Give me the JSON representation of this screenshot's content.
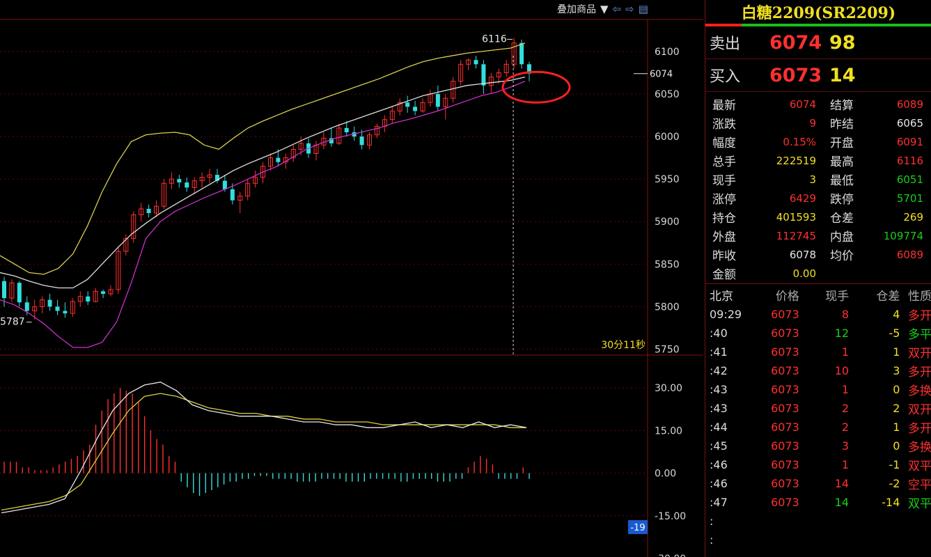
{
  "toolbar": {
    "overlay_label": "叠加商品",
    "dropdown_icon": "triangle-down-icon",
    "prev_icon": "arrow-left-icon",
    "next_icon": "arrow-right-icon",
    "layout_icon": "panel-layout-icon"
  },
  "colors": {
    "up": "#ff3030",
    "down": "#33dddd",
    "boll_upper": "#d8d050",
    "boll_mid": "#e0e0e0",
    "boll_lower": "#cc30cc",
    "macd_dif": "#e8e8e8",
    "macd_dea": "#e0d040",
    "highlight_circle": "#ff2020"
  },
  "chart_data": [
    {
      "type": "candlestick",
      "y_ticks": [
        "6100",
        "6050",
        "6000",
        "5950",
        "5900",
        "5850",
        "5800",
        "5750"
      ],
      "ylim": [
        5743,
        6136
      ],
      "annotations": {
        "high_label": "6116",
        "low_label": "5787",
        "last_label": "6074",
        "countdown": "30分11秒"
      },
      "ohlc": [
        [
          5830,
          5835,
          5800,
          5810
        ],
        [
          5810,
          5832,
          5805,
          5828
        ],
        [
          5828,
          5830,
          5800,
          5805
        ],
        [
          5805,
          5812,
          5790,
          5795
        ],
        [
          5795,
          5808,
          5785,
          5800
        ],
        [
          5800,
          5812,
          5792,
          5808
        ],
        [
          5808,
          5815,
          5795,
          5800
        ],
        [
          5800,
          5808,
          5790,
          5795
        ],
        [
          5795,
          5805,
          5787,
          5792
        ],
        [
          5792,
          5810,
          5788,
          5806
        ],
        [
          5806,
          5818,
          5800,
          5812
        ],
        [
          5812,
          5818,
          5802,
          5806
        ],
        [
          5806,
          5822,
          5805,
          5818
        ],
        [
          5818,
          5820,
          5810,
          5815
        ],
        [
          5815,
          5825,
          5812,
          5820
        ],
        [
          5820,
          5870,
          5815,
          5865
        ],
        [
          5865,
          5885,
          5860,
          5880
        ],
        [
          5880,
          5912,
          5875,
          5908
        ],
        [
          5908,
          5922,
          5900,
          5915
        ],
        [
          5915,
          5920,
          5905,
          5910
        ],
        [
          5910,
          5925,
          5905,
          5918
        ],
        [
          5918,
          5950,
          5915,
          5945
        ],
        [
          5945,
          5958,
          5938,
          5950
        ],
        [
          5950,
          5955,
          5940,
          5946
        ],
        [
          5946,
          5952,
          5935,
          5940
        ],
        [
          5940,
          5952,
          5932,
          5948
        ],
        [
          5948,
          5958,
          5940,
          5952
        ],
        [
          5952,
          5962,
          5945,
          5955
        ],
        [
          5955,
          5962,
          5945,
          5948
        ],
        [
          5948,
          5955,
          5935,
          5938
        ],
        [
          5938,
          5945,
          5920,
          5925
        ],
        [
          5925,
          5935,
          5910,
          5930
        ],
        [
          5930,
          5950,
          5925,
          5945
        ],
        [
          5945,
          5960,
          5940,
          5952
        ],
        [
          5952,
          5970,
          5945,
          5965
        ],
        [
          5965,
          5980,
          5960,
          5975
        ],
        [
          5975,
          5985,
          5965,
          5970
        ],
        [
          5970,
          5980,
          5962,
          5975
        ],
        [
          5975,
          5990,
          5970,
          5985
        ],
        [
          5985,
          6000,
          5978,
          5992
        ],
        [
          5992,
          5998,
          5975,
          5980
        ],
        [
          5980,
          5995,
          5972,
          5990
        ],
        [
          5990,
          6005,
          5985,
          5998
        ],
        [
          5998,
          6010,
          5988,
          5992
        ],
        [
          5992,
          6015,
          5990,
          6010
        ],
        [
          6010,
          6018,
          6000,
          6005
        ],
        [
          6005,
          6012,
          5995,
          6000
        ],
        [
          6000,
          6008,
          5985,
          5990
        ],
        [
          5990,
          6005,
          5985,
          6002
        ],
        [
          6002,
          6015,
          5998,
          6012
        ],
        [
          6012,
          6025,
          6005,
          6020
        ],
        [
          6020,
          6035,
          6015,
          6030
        ],
        [
          6030,
          6045,
          6025,
          6040
        ],
        [
          6040,
          6048,
          6028,
          6035
        ],
        [
          6035,
          6042,
          6025,
          6030
        ],
        [
          6030,
          6045,
          6028,
          6040
        ],
        [
          6040,
          6055,
          6035,
          6050
        ],
        [
          6050,
          6060,
          6030,
          6035
        ],
        [
          6035,
          6050,
          6020,
          6045
        ],
        [
          6045,
          6070,
          6040,
          6065
        ],
        [
          6065,
          6090,
          6060,
          6085
        ],
        [
          6085,
          6092,
          6078,
          6090
        ],
        [
          6090,
          6095,
          6080,
          6085
        ],
        [
          6085,
          6090,
          6050,
          6060
        ],
        [
          6060,
          6075,
          6050,
          6070
        ],
        [
          6070,
          6080,
          6062,
          6075
        ],
        [
          6075,
          6090,
          6070,
          6085
        ],
        [
          6085,
          6116,
          6080,
          6110
        ],
        [
          6110,
          6114,
          6080,
          6085
        ],
        [
          6085,
          6088,
          6065,
          6074
        ]
      ],
      "boll_upper": [
        5860,
        5850,
        5840,
        5838,
        5845,
        5862,
        5895,
        5935,
        5968,
        5994,
        6002,
        6004,
        6005,
        6002,
        5990,
        5985,
        5998,
        6010,
        6018,
        6025,
        6032,
        6038,
        6044,
        6050,
        6056,
        6062,
        6068,
        6075,
        6082,
        6088,
        6092,
        6095,
        6098,
        6100,
        6102,
        6104,
        6110
      ],
      "boll_mid": [
        5840,
        5836,
        5830,
        5825,
        5822,
        5822,
        5832,
        5850,
        5868,
        5885,
        5898,
        5910,
        5920,
        5930,
        5940,
        5950,
        5960,
        5968,
        5975,
        5982,
        5990,
        5998,
        6005,
        6012,
        6018,
        6024,
        6030,
        6036,
        6042,
        6048,
        6052,
        6056,
        6060,
        6062,
        6064,
        6066,
        6070
      ],
      "boll_lower": [
        5808,
        5802,
        5792,
        5780,
        5765,
        5752,
        5752,
        5758,
        5782,
        5828,
        5880,
        5900,
        5912,
        5920,
        5928,
        5935,
        5942,
        5950,
        5958,
        5965,
        5975,
        5985,
        5992,
        5998,
        6002,
        6006,
        6010,
        6016,
        6020,
        6025,
        6030,
        6036,
        6042,
        6048,
        6052,
        6058,
        6065
      ]
    },
    {
      "type": "macd",
      "y_ticks": [
        "30.00",
        "15.00",
        "0.00",
        "-15.00",
        "-30.00"
      ],
      "ylim": [
        -30,
        30
      ],
      "current_label": "-19",
      "hist": [
        4,
        4,
        4,
        2,
        2,
        1,
        1,
        1,
        2,
        3,
        4,
        5,
        6,
        8,
        10,
        17,
        22,
        26,
        28,
        30,
        29,
        28,
        25,
        20,
        15,
        12,
        10,
        6,
        4,
        -3,
        -5,
        -7,
        -8,
        -7,
        -6,
        -5,
        -4,
        -3,
        -3,
        -2,
        -2,
        -1,
        -1,
        -1,
        -2,
        -2,
        -2,
        -2,
        -3,
        -3,
        -3,
        -3,
        -2,
        -2,
        -2,
        -2,
        -3,
        -3,
        -3,
        -3,
        -2,
        -2,
        -2,
        -2,
        -2,
        -3,
        -3,
        -2,
        -2,
        -2,
        -2,
        -3,
        -3,
        -3,
        -2,
        -2,
        2,
        4,
        6,
        5,
        3,
        -2,
        -2,
        -2,
        -2,
        2,
        -2
      ],
      "dif": [
        -14,
        -13,
        -12,
        -11,
        -9,
        1,
        12,
        22,
        28,
        31,
        32,
        29,
        24,
        22,
        21,
        20,
        20,
        20,
        19,
        18,
        18,
        17,
        17,
        16,
        16,
        17,
        18,
        16,
        17,
        16,
        18,
        16,
        17,
        16
      ],
      "dea": [
        -13,
        -12,
        -11,
        -10,
        -8,
        -4,
        5,
        14,
        22,
        27,
        28,
        27,
        25,
        23,
        22,
        21,
        21,
        20,
        20,
        19,
        19,
        18,
        18,
        18,
        17,
        17,
        17,
        17,
        17,
        17,
        17,
        17,
        16,
        16
      ]
    }
  ],
  "panel": {
    "title": "白糖2209(SR2209)",
    "ask_label": "卖出",
    "ask_price": "6074",
    "ask_volume": "98",
    "bid_label": "买入",
    "bid_price": "6073",
    "bid_volume": "14",
    "stats": [
      {
        "k": "最新",
        "v": "6074",
        "vc": "red",
        "k2": "结算",
        "v2": "6089",
        "v2c": "red"
      },
      {
        "k": "涨跌",
        "v": "9",
        "vc": "red",
        "k2": "昨结",
        "v2": "6065",
        "v2c": "white"
      },
      {
        "k": "幅度",
        "v": "0.15%",
        "vc": "red",
        "k2": "开盘",
        "v2": "6091",
        "v2c": "red"
      },
      {
        "k": "总手",
        "v": "222519",
        "vc": "yellow",
        "k2": "最高",
        "v2": "6116",
        "v2c": "red"
      },
      {
        "k": "现手",
        "v": "3",
        "vc": "yellow",
        "k2": "最低",
        "v2": "6051",
        "v2c": "green"
      },
      {
        "k": "涨停",
        "v": "6429",
        "vc": "red",
        "k2": "跌停",
        "v2": "5701",
        "v2c": "green"
      },
      {
        "k": "持仓",
        "v": "401593",
        "vc": "yellow",
        "k2": "仓差",
        "v2": "269",
        "v2c": "yellow"
      },
      {
        "k": "外盘",
        "v": "112745",
        "vc": "red",
        "k2": "内盘",
        "v2": "109774",
        "v2c": "green"
      },
      {
        "k": "昨收",
        "v": "6078",
        "vc": "white",
        "k2": "均价",
        "v2": "6089",
        "v2c": "red"
      },
      {
        "k": "金额",
        "v": "0.00",
        "vc": "yellow",
        "k2": "",
        "v2": "",
        "v2c": "white"
      }
    ],
    "ticks_header": [
      "北京",
      "价格",
      "现手",
      "仓差",
      "性质"
    ],
    "ticks": [
      {
        "t": "09:29",
        "p": "6073",
        "v": "8",
        "vc": "red",
        "o": "4",
        "oc": "yellow",
        "n": "多开",
        "nc": "red"
      },
      {
        "t": ":40",
        "p": "6073",
        "v": "12",
        "vc": "green",
        "o": "-5",
        "oc": "yellow",
        "n": "多平",
        "nc": "green"
      },
      {
        "t": ":41",
        "p": "6073",
        "v": "1",
        "vc": "red",
        "o": "1",
        "oc": "yellow",
        "n": "双开",
        "nc": "red"
      },
      {
        "t": ":42",
        "p": "6073",
        "v": "10",
        "vc": "red",
        "o": "3",
        "oc": "yellow",
        "n": "多开",
        "nc": "red"
      },
      {
        "t": ":43",
        "p": "6073",
        "v": "1",
        "vc": "red",
        "o": "0",
        "oc": "yellow",
        "n": "多换",
        "nc": "red"
      },
      {
        "t": ":43",
        "p": "6073",
        "v": "2",
        "vc": "red",
        "o": "2",
        "oc": "yellow",
        "n": "双开",
        "nc": "red"
      },
      {
        "t": ":44",
        "p": "6073",
        "v": "2",
        "vc": "red",
        "o": "1",
        "oc": "yellow",
        "n": "多开",
        "nc": "red"
      },
      {
        "t": ":45",
        "p": "6073",
        "v": "3",
        "vc": "red",
        "o": "0",
        "oc": "yellow",
        "n": "多换",
        "nc": "red"
      },
      {
        "t": ":46",
        "p": "6073",
        "v": "1",
        "vc": "red",
        "o": "-1",
        "oc": "yellow",
        "n": "双平",
        "nc": "red"
      },
      {
        "t": ":46",
        "p": "6073",
        "v": "14",
        "vc": "red",
        "o": "-2",
        "oc": "yellow",
        "n": "空平",
        "nc": "red"
      },
      {
        "t": ":47",
        "p": "6073",
        "v": "14",
        "vc": "green",
        "o": "-14",
        "oc": "yellow",
        "n": "双平",
        "nc": "green"
      },
      {
        "t": ":",
        "p": "",
        "v": "",
        "vc": "red",
        "o": "",
        "oc": "yellow",
        "n": "",
        "nc": "red"
      },
      {
        "t": ":",
        "p": "",
        "v": "",
        "vc": "red",
        "o": "",
        "oc": "yellow",
        "n": "",
        "nc": "red"
      }
    ]
  }
}
